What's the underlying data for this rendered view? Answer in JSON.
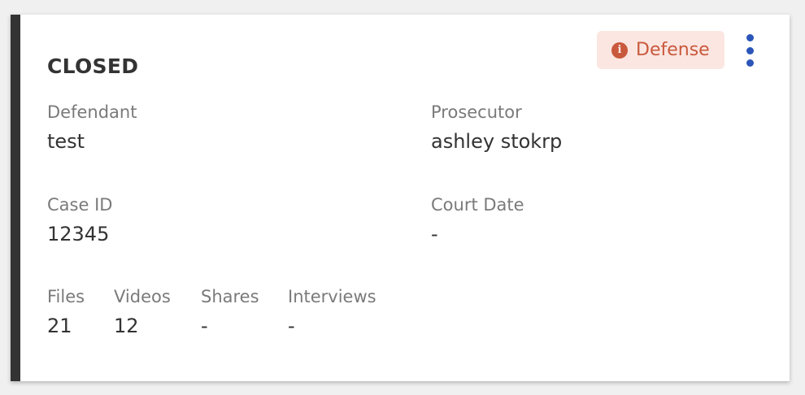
{
  "case": {
    "status": "CLOSED",
    "badge": {
      "icon": "info-icon",
      "icon_glyph": "i",
      "label": "Defense",
      "color": "#c9593c",
      "background": "#fbe6e1"
    },
    "menu_icon": "more-vertical-icon",
    "accent_color": "#333333",
    "fields": {
      "defendant": {
        "label": "Defendant",
        "value": "test"
      },
      "prosecutor": {
        "label": "Prosecutor",
        "value": "ashley stokrp"
      },
      "case_id": {
        "label": "Case ID",
        "value": "12345"
      },
      "court_date": {
        "label": "Court Date",
        "value": "-"
      }
    },
    "stats": {
      "files": {
        "label": "Files",
        "value": "21"
      },
      "videos": {
        "label": "Videos",
        "value": "12"
      },
      "shares": {
        "label": "Shares",
        "value": "-"
      },
      "interviews": {
        "label": "Interviews",
        "value": "-"
      }
    }
  }
}
